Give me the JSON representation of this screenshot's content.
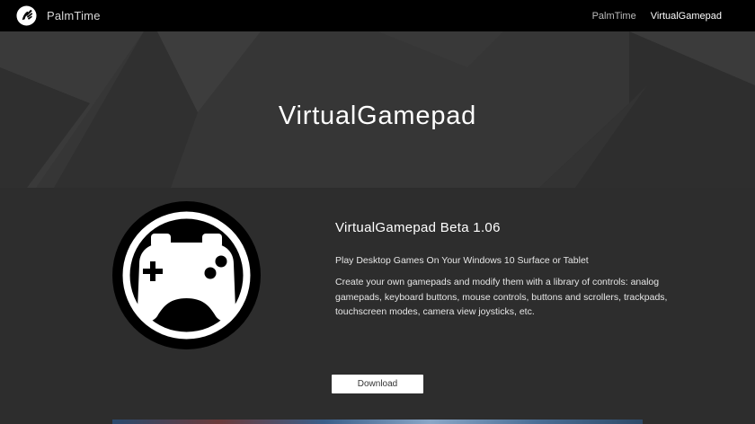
{
  "navbar": {
    "brand_name": "PalmTime",
    "links": [
      {
        "label": "PalmTime",
        "active": false
      },
      {
        "label": "VirtualGamepad",
        "active": true
      }
    ]
  },
  "hero": {
    "title": "VirtualGamepad"
  },
  "product": {
    "title": "VirtualGamepad Beta 1.06",
    "tagline": "Play Desktop Games On Your Windows 10 Surface or Tablet",
    "description": "Create your own gamepads and modify them with a library of controls: analog gamepads, keyboard buttons, mouse controls, buttons and scrollers, trackpads, touchscreen modes, camera view joysticks, etc.",
    "download_label": "Download",
    "icon": "gamepad-icon"
  },
  "colors": {
    "navbar_bg": "#000000",
    "hero_bg": "#353535",
    "content_bg": "#2d2d2d",
    "button_bg": "#ffffff"
  }
}
